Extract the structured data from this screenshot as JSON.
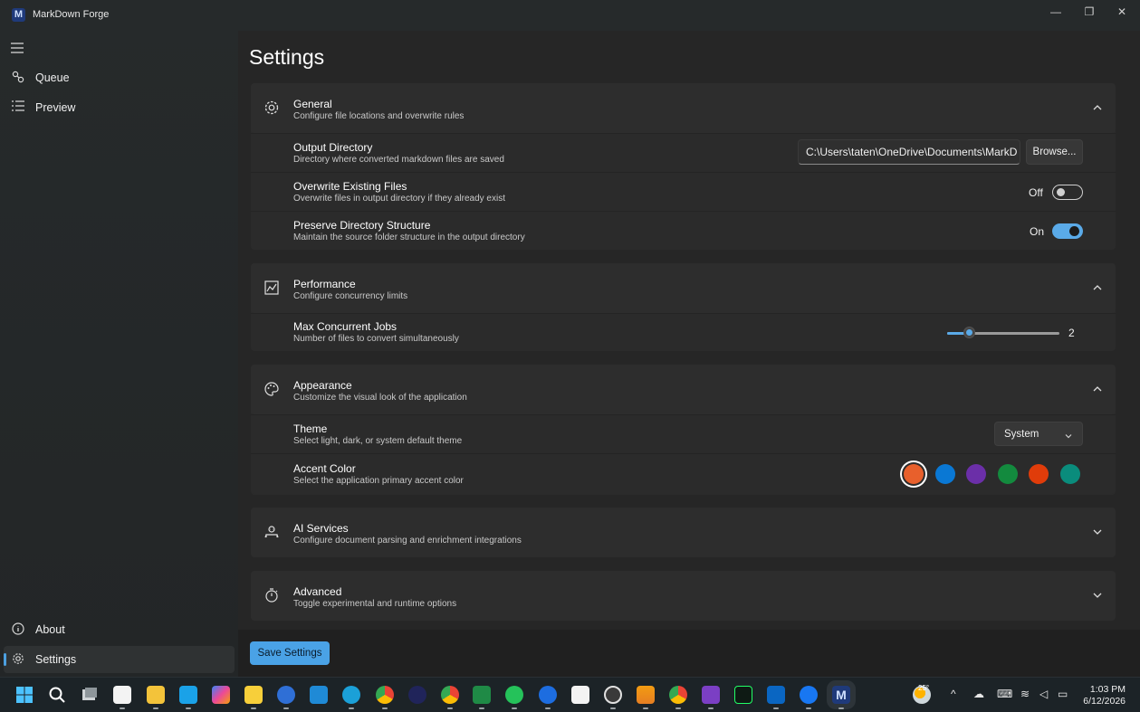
{
  "window": {
    "title": "MarkDown Forge",
    "logo_letter": "M",
    "minimize": "—",
    "maximize": "❐",
    "close": "✕"
  },
  "sidebar": {
    "menu_icon": "hamburger-icon",
    "items": [
      {
        "label": "Queue",
        "icon": "queue-icon"
      },
      {
        "label": "Preview",
        "icon": "list-icon"
      }
    ],
    "bottom_items": [
      {
        "label": "About",
        "icon": "info-icon"
      },
      {
        "label": "Settings",
        "icon": "gear-icon",
        "active": true
      }
    ]
  },
  "page": {
    "title": "Settings",
    "save_label": "Save Settings"
  },
  "general": {
    "title": "General",
    "subtitle": "Configure file locations and overwrite rules",
    "output_dir": {
      "title": "Output Directory",
      "subtitle": "Directory where converted markdown files are saved",
      "value": "C:\\Users\\taten\\OneDrive\\Documents\\MarkD",
      "browse_label": "Browse..."
    },
    "overwrite": {
      "title": "Overwrite Existing Files",
      "subtitle": "Overwrite files in output directory if they already exist",
      "state_label": "Off",
      "on": false
    },
    "preserve": {
      "title": "Preserve Directory Structure",
      "subtitle": "Maintain the source folder structure in the output directory",
      "state_label": "On",
      "on": true
    }
  },
  "performance": {
    "title": "Performance",
    "subtitle": "Configure concurrency limits",
    "max_jobs": {
      "title": "Max Concurrent Jobs",
      "subtitle": "Number of files to convert simultaneously",
      "value": "2",
      "fraction": 0.19
    }
  },
  "appearance": {
    "title": "Appearance",
    "subtitle": "Customize the visual look of the application",
    "theme": {
      "title": "Theme",
      "subtitle": "Select light, dark, or system default theme",
      "value": "System"
    },
    "accent": {
      "title": "Accent Color",
      "subtitle": "Select the application primary accent color",
      "colors": [
        "#e8602c",
        "#0a78d4",
        "#6b2fa8",
        "#138a3e",
        "#e03c0a",
        "#0a8c7c"
      ],
      "selected_index": 0
    }
  },
  "ai_services": {
    "title": "AI Services",
    "subtitle": "Configure document parsing and enrichment integrations"
  },
  "advanced": {
    "title": "Advanced",
    "subtitle": "Toggle experimental and runtime options"
  },
  "taskbar": {
    "weather_temp": "25°",
    "time": "1:03 PM",
    "date": "6/12/2026"
  }
}
